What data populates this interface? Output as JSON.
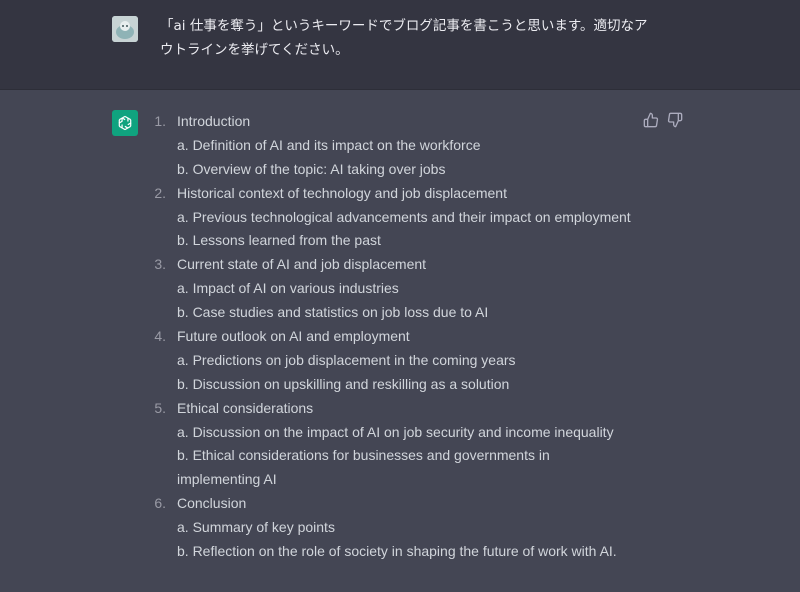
{
  "user": {
    "message": "「ai 仕事を奪う」というキーワードでブログ記事を書こうと思います。適切なアウトラインを挙げてください。"
  },
  "assistant": {
    "outline": [
      {
        "number": "1.",
        "title": "Introduction",
        "items": [
          "a. Definition of AI and its impact on the workforce",
          "b. Overview of the topic: AI taking over jobs"
        ]
      },
      {
        "number": "2.",
        "title": "Historical context of technology and job displacement",
        "items": [
          "a. Previous technological advancements and their impact on employment",
          "b. Lessons learned from the past"
        ]
      },
      {
        "number": "3.",
        "title": "Current state of AI and job displacement",
        "items": [
          "a. Impact of AI on various industries",
          "b. Case studies and statistics on job loss due to AI"
        ]
      },
      {
        "number": "4.",
        "title": "Future outlook on AI and employment",
        "items": [
          "a. Predictions on job displacement in the coming years",
          "b. Discussion on upskilling and reskilling as a solution"
        ]
      },
      {
        "number": "5.",
        "title": "Ethical considerations",
        "items": [
          "a. Discussion on the impact of AI on job security and income inequality",
          "b. Ethical considerations for businesses and governments in",
          "implementing AI"
        ]
      },
      {
        "number": "6.",
        "title": "Conclusion",
        "items": [
          "a. Summary of key points",
          "b. Reflection on the role of society in shaping the future of work with AI."
        ]
      }
    ]
  },
  "icons": {
    "user_avatar": "user-avatar-icon",
    "assistant_avatar": "openai-logo-icon",
    "thumbs_up": "thumbs-up-icon",
    "thumbs_down": "thumbs-down-icon"
  },
  "colors": {
    "user_bg": "#343541",
    "assistant_bg": "#444654",
    "brand_green": "#10a37f"
  }
}
